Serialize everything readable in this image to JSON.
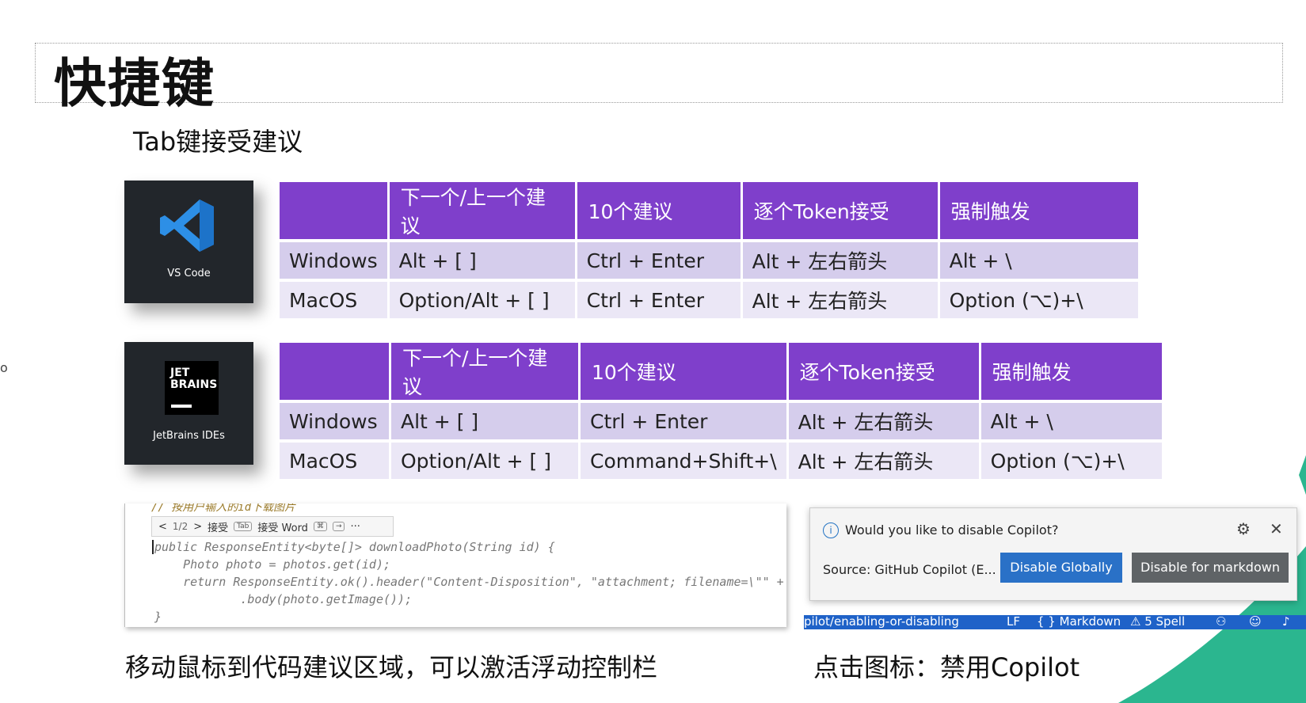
{
  "slide": {
    "title": "快捷键",
    "subtitle": "Tab键接受建议",
    "left_mark": "o",
    "caption_left": "移动鼠标到代码建议区域，可以激活浮动控制栏",
    "caption_right": "点击图标：禁用Copilot"
  },
  "vscode": {
    "logo_label": "VS Code",
    "headers": [
      "",
      "下一个/上一个建议",
      "10个建议",
      "逐个Token接受",
      "强制触发"
    ],
    "rows": [
      [
        "Windows",
        "Alt + [ ]",
        "Ctrl + Enter",
        "Alt + 左右箭头",
        "Alt + \\"
      ],
      [
        "MacOS",
        "Option/Alt + [ ]",
        "Ctrl + Enter",
        "Alt + 左右箭头",
        "Option (⌥)+\\"
      ]
    ]
  },
  "jetbrains": {
    "logo_text": "JET BRAINS",
    "logo_label": "JetBrains IDEs",
    "headers": [
      "",
      "下一个/上一个建议",
      "10个建议",
      "逐个Token接受",
      "强制触发"
    ],
    "rows": [
      [
        "Windows",
        "Alt + [ ]",
        "Ctrl + Enter",
        "Alt + 左右箭头",
        "Alt + \\"
      ],
      [
        "MacOS",
        "Option/Alt + [ ]",
        "Command+Shift+\\",
        "Alt + 左右箭头",
        "Option (⌥)+\\"
      ]
    ]
  },
  "editor": {
    "comment": "// 按用户输入的id下载图片",
    "toolbar": {
      "prev": "<",
      "counter": "1/2",
      "next": ">",
      "accept": "接受",
      "accept_key": "Tab",
      "accept_word": "接受 Word",
      "cmd_key": "⌘",
      "arrow_key": "→",
      "more": "···"
    },
    "lines": [
      "public ResponseEntity<byte[]> downloadPhoto(String id) {",
      "    Photo photo = photos.get(id);",
      "    return ResponseEntity.ok().header(\"Content-Disposition\", \"attachment; filename=\\\"\" +",
      "            .body(photo.getImage());",
      "}"
    ]
  },
  "notification": {
    "question": "Would you like to disable Copilot?",
    "source": "Source: GitHub Copilot (E...",
    "primary_button": "Disable Globally",
    "secondary_button": "Disable for markdown",
    "info_glyph": "i",
    "gear_glyph": "⚙",
    "close_glyph": "✕"
  },
  "statusbar": {
    "path": "pilot/enabling-or-disabling",
    "eol": "LF",
    "language": "{ } Markdown",
    "spell": "⚠ 5 Spell"
  },
  "colors": {
    "header_purple": "#7f3fcb",
    "row_light1": "#d5cdec",
    "row_light2": "#ebe7f6",
    "accent_green": "#2bb68f",
    "button_blue": "#2a71c7",
    "statusbar_blue": "#1f62c8"
  }
}
